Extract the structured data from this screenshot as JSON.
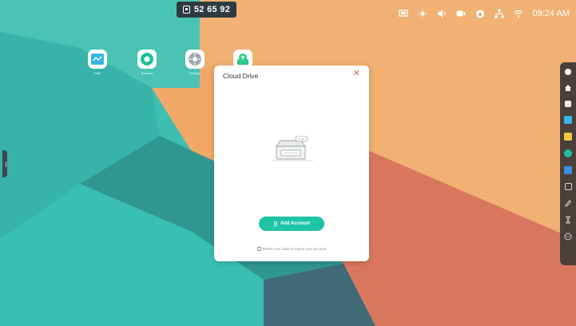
{
  "top_code": "52 65 92",
  "status_bar": {
    "time": "09:24 AM",
    "icons": [
      "screen-share-icon",
      "brightness-icon",
      "volume-icon",
      "camera-icon",
      "eye-care-icon",
      "network-icon",
      "wifi-icon"
    ]
  },
  "desktop_apps": [
    {
      "label": "Note",
      "icon": "note-icon",
      "color": "#35b6e8"
    },
    {
      "label": "Browser",
      "icon": "browser-icon",
      "color": "#1fbf9d"
    },
    {
      "label": "Settings",
      "icon": "settings-icon",
      "color": "#9ea7ad"
    },
    {
      "label": "",
      "icon": "cloud-drive-icon",
      "color": "#2fcb8a"
    }
  ],
  "dialog": {
    "title": "Cloud Drive",
    "illustration_bubble": "Empty",
    "add_account_label": "Add Account",
    "delete_hint": "Delete user data on logout your account"
  },
  "right_toolbar": [
    "back-icon",
    "home-icon",
    "recent-apps-icon",
    "note-app-icon",
    "folder-app-icon",
    "browser-app-icon",
    "apps-grid-icon",
    "screen-share-icon",
    "annotate-icon",
    "timer-icon",
    "more-icon"
  ],
  "colors": {
    "accent": "#1fc4a6",
    "close": "#e25b4f",
    "teal_bg": "#3dbfb0",
    "orange_bg": "#f0aa70"
  }
}
